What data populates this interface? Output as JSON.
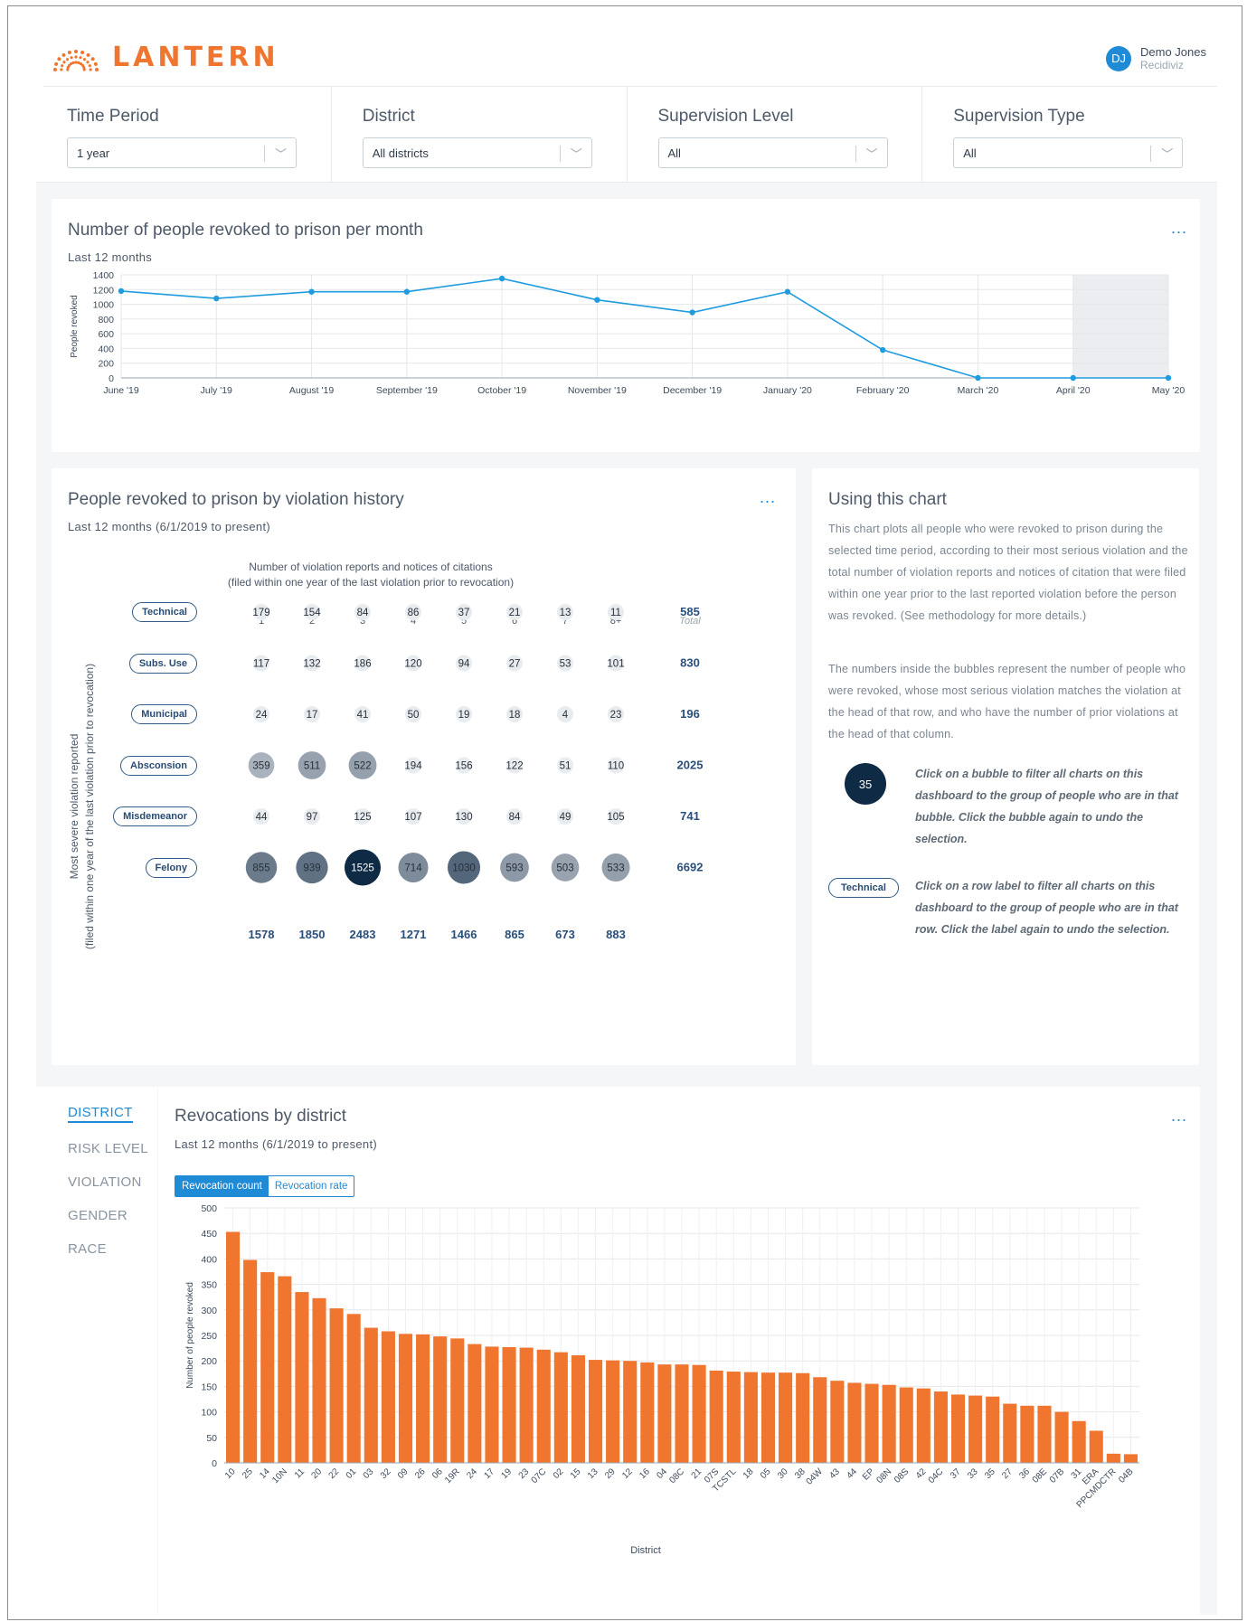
{
  "brand": {
    "name": "LANTERN",
    "color": "#f0762f"
  },
  "user": {
    "initials": "DJ",
    "name": "Demo Jones",
    "org": "Recidiviz"
  },
  "filters": [
    {
      "label": "Time Period",
      "value": "1 year"
    },
    {
      "label": "District",
      "value": "All districts"
    },
    {
      "label": "Supervision Level",
      "value": "All"
    },
    {
      "label": "Supervision Type",
      "value": "All"
    }
  ],
  "monthly": {
    "title": "Number of people revoked to prison per month",
    "subtitle": "Last 12 months",
    "menu": "...",
    "chart_data": {
      "type": "line",
      "ylabel": "People revoked",
      "ylim": [
        0,
        1400
      ],
      "yticks": [
        0,
        200,
        400,
        600,
        800,
        1000,
        1200,
        1400
      ],
      "categories": [
        "June '19",
        "July '19",
        "August '19",
        "September '19",
        "October '19",
        "November '19",
        "December '19",
        "January '20",
        "February '20",
        "March '20",
        "April '20",
        "May '20"
      ],
      "values": [
        1180,
        1080,
        1170,
        1170,
        1350,
        1060,
        890,
        1170,
        380,
        0,
        0,
        0
      ],
      "shaded_categories": [
        "April '20",
        "May '20"
      ],
      "color": "#1f9be0"
    }
  },
  "matrix": {
    "title": "People revoked to prison by violation history",
    "subtitle": "Last 12 months (6/1/2019 to present)",
    "menu": "...",
    "xtitle1": "Number of violation reports and notices of citations",
    "xtitle2": "(filed within one year of the last violation prior to revocation)",
    "ytitle1": "Most severe violation reported",
    "ytitle2": "(filed within one year of the last violation prior to revocation)",
    "columns": [
      "1",
      "2",
      "3",
      "4",
      "5",
      "6",
      "7",
      "8+"
    ],
    "total_label": "Total",
    "chart_data": {
      "type": "heatmap",
      "rows": [
        "Technical",
        "Subs. Use",
        "Municipal",
        "Absconsion",
        "Misdemeanor",
        "Felony"
      ],
      "columns": [
        "1",
        "2",
        "3",
        "4",
        "5",
        "6",
        "7",
        "8+"
      ],
      "values": [
        [
          179,
          154,
          84,
          86,
          37,
          21,
          13,
          11
        ],
        [
          117,
          132,
          186,
          120,
          94,
          27,
          53,
          101
        ],
        [
          24,
          17,
          41,
          50,
          19,
          18,
          4,
          23
        ],
        [
          359,
          511,
          522,
          194,
          156,
          122,
          51,
          110
        ],
        [
          44,
          97,
          125,
          107,
          130,
          84,
          49,
          105
        ],
        [
          855,
          939,
          1525,
          714,
          1030,
          593,
          503,
          533
        ]
      ],
      "row_totals": [
        585,
        830,
        196,
        2025,
        741,
        6692
      ],
      "column_totals": [
        1578,
        1850,
        2483,
        1271,
        1466,
        865,
        673,
        883
      ]
    }
  },
  "help": {
    "title": "Using this chart",
    "p1": "This chart plots all people who were revoked to prison during the selected time period, according to their most serious violation and the total number of violation reports and notices of citation that were filed within one year prior to the last reported violation before the person was revoked. (See methodology for more details.)",
    "p2": "The numbers inside the bubbles represent the number of people who were revoked, whose most serious violation matches the violation at the head of that row, and who have the number of prior violations at the head of that column.",
    "bubble_example": "35",
    "bubble_text": "Click on a bubble to filter all charts on this dashboard to the group of people who are in that bubble. Click the bubble again to undo the selection.",
    "label_example": "Technical",
    "label_text": "Click on a row label to filter all charts on this dashboard to the group of people who are in that row. Click the label again to undo the selection."
  },
  "dimension_tabs": [
    "DISTRICT",
    "RISK LEVEL",
    "VIOLATION",
    "GENDER",
    "RACE"
  ],
  "district": {
    "title": "Revocations by district",
    "subtitle": "Last 12 months (6/1/2019 to present)",
    "menu": "...",
    "toggle": [
      "Revocation count",
      "Revocation rate"
    ],
    "chart_data": {
      "type": "bar",
      "xlabel": "District",
      "ylabel": "Number of people revoked",
      "ylim": [
        0,
        500
      ],
      "yticks": [
        0,
        50,
        100,
        150,
        200,
        250,
        300,
        350,
        400,
        450,
        500
      ],
      "color": "#f0762f",
      "categories": [
        "10",
        "25",
        "14",
        "10N",
        "11",
        "20",
        "22",
        "01",
        "03",
        "32",
        "09",
        "26",
        "06",
        "19R",
        "24",
        "17",
        "19",
        "23",
        "07C",
        "02",
        "15",
        "13",
        "29",
        "12",
        "16",
        "04",
        "08C",
        "21",
        "07S",
        "TCSTL",
        "18",
        "05",
        "30",
        "38",
        "04W",
        "43",
        "44",
        "EP",
        "08N",
        "08S",
        "42",
        "04C",
        "37",
        "33",
        "35",
        "27",
        "36",
        "08E",
        "07B",
        "31",
        "ERA",
        "PPCMDCTR",
        "04B"
      ],
      "values": [
        453,
        398,
        374,
        366,
        335,
        323,
        303,
        292,
        265,
        258,
        253,
        252,
        248,
        244,
        233,
        228,
        227,
        226,
        222,
        217,
        211,
        202,
        201,
        200,
        197,
        193,
        193,
        192,
        181,
        179,
        178,
        177,
        177,
        176,
        168,
        161,
        157,
        155,
        153,
        148,
        146,
        140,
        134,
        132,
        130,
        116,
        112,
        112,
        100,
        82,
        63,
        18,
        17
      ]
    }
  }
}
